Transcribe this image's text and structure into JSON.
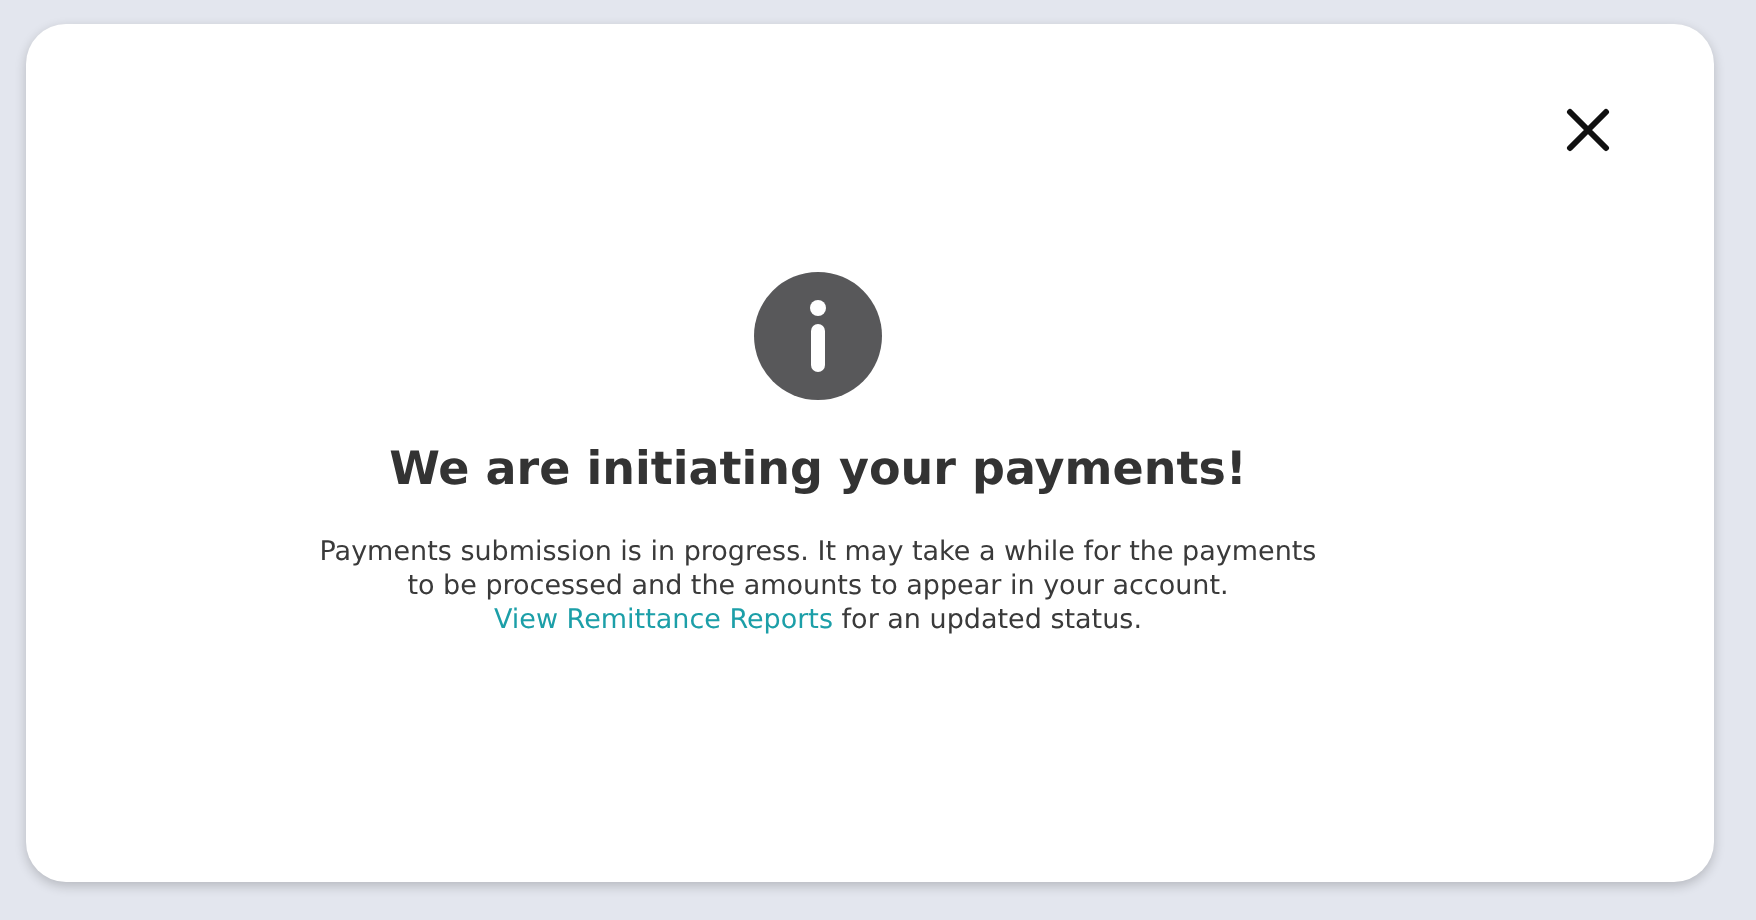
{
  "dialog": {
    "title": "We are initiating your payments!",
    "message": {
      "lines": [
        "Payments submission is in progress. It may take a while for the payments",
        "to be processed and the amounts to appear in your account."
      ],
      "link": "View Remittance Reports",
      "after": " for an updated status."
    }
  }
}
